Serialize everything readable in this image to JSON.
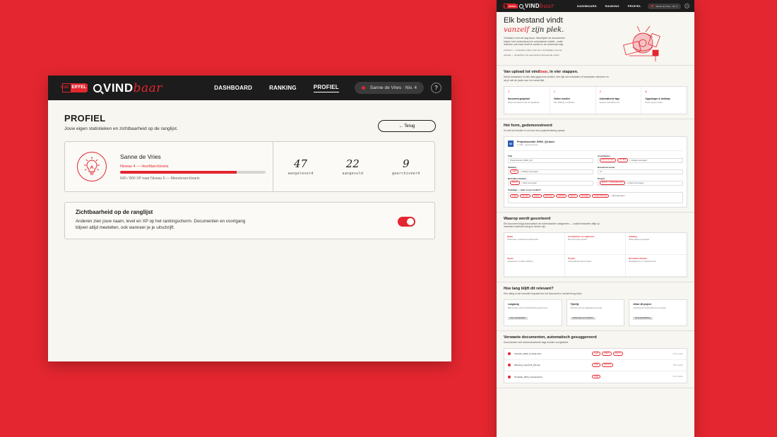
{
  "brand": {
    "logo_a": "todd",
    "logo_b": "EIFFEL",
    "word_a": "VIND",
    "word_b": "baar"
  },
  "nav": {
    "links": [
      "DASHBOARD",
      "RANKING",
      "PROFIEL"
    ],
    "user": "Sanne de Vries · Niv. 4",
    "help": "?"
  },
  "profile": {
    "title": "PROFIEL",
    "subtitle": "Jouw eigen statistieken en zichtbaarheid op de ranglijst.",
    "back_label": "← Terug",
    "name": "Sanne de Vries",
    "level": "Niveau 4 — Hoofdarchivaris",
    "xp_fraction": 0.8,
    "xp_text": "640 / 800 XP naar Niveau 5 — Meesterarchivaris",
    "stats": [
      {
        "value": "47",
        "label": "aangeleverd"
      },
      {
        "value": "22",
        "label": "aangevuld"
      },
      {
        "value": "9",
        "label": "gearchiveerd"
      }
    ],
    "visibility": {
      "title": "Zichtbaarheid op de ranglijst",
      "text": "Anderen zien jouw naam, level en XP op het rankingscherm. Documenten en voortgang blijven altijd meetellen, ook wanneer je je uitschrijft.",
      "enabled": true
    }
  },
  "landing": {
    "hero_line1": "Elk bestand vindt",
    "hero_line2_accent": "vanzelf",
    "hero_line2_rest": "zijn plek.",
    "hero_text": "Vindbaar is een de dag bouw. Steentijden de documenten helpen toch ondersteund en automatisch indeelt - zodat iedereen ook maar hoeft te zoeken in de verkeerde map.",
    "hero_foot1": "Probleem — bestanden raken zoek door onduidelijke structuur",
    "hero_foot2": "Aanpak — uploadhulp met automatisch gesorteerde velden",
    "steps_title_a": "Van upload tot vind",
    "steps_title_accent": "baar",
    "steps_title_b": ", in vier stappen.",
    "steps_sub": "Met je bestanden en alle data-gegevens invullen, een lijst met resultaten of bestanden uitvoeren en als je niet de juiste voor het meest lijkt.",
    "steps": [
      {
        "n": "1",
        "t": "Document geüpload",
        "d": "Sleep een bestand naar de uploadhulp"
      },
      {
        "n": "2",
        "t": "Velden invullen",
        "d": "Titel, afdeling, contribuant"
      },
      {
        "n": "3",
        "t": "Automatische tags",
        "d": "Systeem stelt labels voor"
      },
      {
        "n": "4",
        "t": "Opgeslagen & vindbaar",
        "d": "Direct terug te vinden"
      }
    ],
    "form_title": "Het form, gedemonstreerd",
    "form_sub": "Zo ziet het invullen er uit voor een projectsortering upload.",
    "file_name": "Projectvoorstel_Eiffel_Q4.docx",
    "file_meta": "1,2 MB · zojuist geüpload",
    "fields": [
      {
        "label": "Titel",
        "value": "Projectvoorstel_Eiffel_Q4",
        "chips": []
      },
      {
        "label": "Contributors",
        "value": "+ collega toevoegen",
        "chips": [
          "Sanne de Vries",
          "Tim Bos"
        ]
      },
      {
        "label": "Afdeling",
        "value": "+ afdeling toevoegen",
        "chips": [
          "Legal"
        ]
      },
      {
        "label": "Document versie",
        "value": "v3",
        "chips": []
      },
      {
        "label": "Betrokken klanten",
        "value": "+ klant toevoegen",
        "chips": [
          "Klant A"
        ]
      },
      {
        "label": "Project",
        "value": "+ project toevoegen",
        "chips": [
          "Klant A — Herpositionering"
        ]
      }
    ],
    "tags_label": "Zoektags — waar zou je zoeken?",
    "tags": [
      "Legal",
      "Voorstel",
      "Offerte",
      "Planning",
      "Q4/2024",
      "Klant A",
      "Strategie",
      "Project Planning",
      "+ tag toevoegen"
    ],
    "sort_title": "Waarop wordt gesorteerd",
    "sort_sub": "Elk document krijgt automatisch de onderstaande categorieën — zodat bestanden altijd op meerdere manieren terug te vinden zijn.",
    "sort_cells": [
      {
        "t": "Naam",
        "d": "Herkenbare, consistente bestandsnaam"
      },
      {
        "t": "Contributors en eigenaren",
        "d": "Wie heeft eraan gewerkt"
      },
      {
        "t": "Afdeling",
        "d": "Welke afdeling is eigenaar"
      },
      {
        "t": "Versie",
        "d": "Versiebeheer en laatste wijziging"
      },
      {
        "t": "Project",
        "d": "Gekoppeld aan lopend project"
      },
      {
        "t": "Betrokken klanten",
        "d": "Klantgegevens en contactpersonen"
      }
    ],
    "ttl_title": "Hoe lang blijft dit relevant?",
    "ttl_sub": "Een uitleg in het formulier bepaalt hoe het document in archief terug komt.",
    "ttl_cards": [
      {
        "t": "Langdurig",
        "d": "Blijft relevant; wordt niet automatisch gearchiveerd",
        "tag": "Geen verloopdatum"
      },
      {
        "t": "Tijdelijk",
        "d": "Relevant voor een afgebakende periode",
        "tag": "Archivering na 6 maanden"
      },
      {
        "t": "Afloer dit project",
        "d": "Gearchiveerd na afronding van het project",
        "tag": "Na projectafsluiting"
      }
    ],
    "rel_title": "Verwante documenten, automatisch gesuggereerd",
    "rel_sub": "Documenten met overeenkomende tags worden voorgesteld.",
    "related": [
      {
        "name": "Voorstel_2023_concept.docx",
        "tags": [
          "Legal",
          "Offerte",
          "Klant A"
        ],
        "match": "92% overlap"
      },
      {
        "name": "Planning_overzicht_Q3.xlsx",
        "tags": [
          "Legal",
          "Planning"
        ],
        "match": "78% overlap"
      },
      {
        "name": "Template_2024_concept.docx",
        "tags": [
          "Legal"
        ],
        "match": "61% overlap"
      }
    ]
  }
}
